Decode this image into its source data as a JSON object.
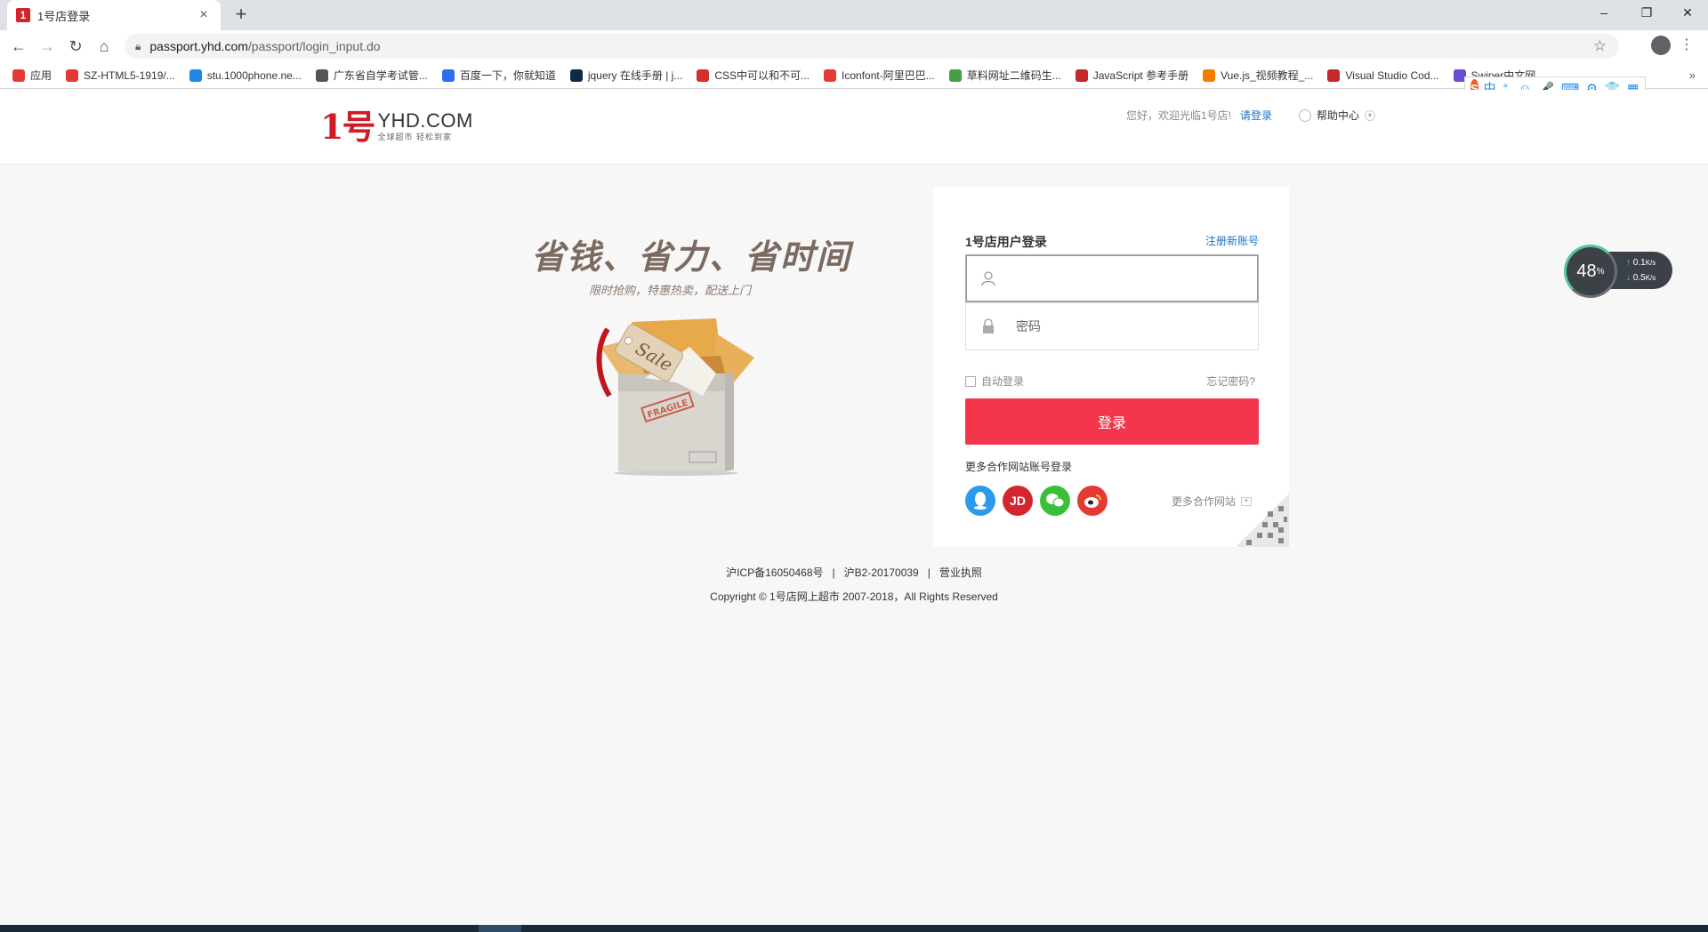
{
  "browser": {
    "tab_title": "1号店登录",
    "tab_close": "×",
    "new_tab": "+",
    "url_host": "passport.yhd.com",
    "url_path": "/passport/login_input.do",
    "window_minimize": "–",
    "window_restore": "❐",
    "window_close": "✕",
    "back": "←",
    "forward": "→",
    "reload": "↻",
    "home": "⌂",
    "star": "☆",
    "kebab": "⋮",
    "bookmarks": [
      {
        "label": "应用",
        "color": "#e53935"
      },
      {
        "label": "SZ-HTML5-1919/...",
        "color": "#e53935"
      },
      {
        "label": "stu.1000phone.ne...",
        "color": "#1e88e5"
      },
      {
        "label": "广东省自学考试管...",
        "color": "#555555"
      },
      {
        "label": "百度一下，你就知道",
        "color": "#2f6df0"
      },
      {
        "label": "jquery 在线手册 | j...",
        "color": "#0d2a4a"
      },
      {
        "label": "CSS中可以和不可...",
        "color": "#d32f2f"
      },
      {
        "label": "Iconfont-阿里巴巴...",
        "color": "#e53935"
      },
      {
        "label": "草料网址二维码生...",
        "color": "#43a047"
      },
      {
        "label": "JavaScript 参考手册",
        "color": "#c62828"
      },
      {
        "label": "Vue.js_视频教程_...",
        "color": "#f57c00"
      },
      {
        "label": "Visual Studio Cod...",
        "color": "#c62828"
      },
      {
        "label": "Swiper中文网",
        "color": "#6a4cd3"
      }
    ],
    "bookmarks_more": "»"
  },
  "header": {
    "logo_mark": "1号",
    "logo_domain": "YHD.COM",
    "logo_slogan": "全球超市 轻松到家",
    "greeting": "您好，欢迎光临1号店!",
    "login_link": "请登录",
    "help_center": "帮助中心"
  },
  "promo": {
    "title": "省钱、省力、省时间",
    "subtitle": "限时抢购，特惠热卖，配送上门",
    "tag_text": "Sale",
    "stamp_text": "FRAGILE"
  },
  "login": {
    "title": "1号店用户登录",
    "register_link": "注册新账号",
    "username_placeholder": "",
    "password_placeholder": "密码",
    "auto_login": "自动登录",
    "forgot_password": "忘记密码?",
    "login_button": "登录",
    "partner_title": "更多合作网站账号登录",
    "social": [
      {
        "name": "qq",
        "glyph": "",
        "color": "#2a9bec"
      },
      {
        "name": "jd",
        "glyph": "JD",
        "color": "#d4262f"
      },
      {
        "name": "wechat",
        "glyph": "",
        "color": "#3bbf3b"
      },
      {
        "name": "weibo",
        "glyph": "",
        "color": "#e53935"
      }
    ],
    "more_sites": "更多合作网站"
  },
  "footer": {
    "line1_icp": "沪ICP备16050468号",
    "line1_sep": "|",
    "line1_b2": "沪B2-20170039",
    "line1_license": "营业执照",
    "line2": "Copyright © 1号店网上超市 2007-2018，All Rights Reserved"
  },
  "speed_widget": {
    "percent": "48",
    "percent_unit": "%",
    "up": "0.1",
    "down": "0.5",
    "unit": "K/s",
    "up_arrow": "↑",
    "down_arrow": "↓"
  },
  "ime": {
    "logo": "S",
    "items": [
      "中",
      "°,",
      "☺",
      "🎤",
      "⌨",
      "⚙",
      "👕",
      "▦"
    ]
  }
}
